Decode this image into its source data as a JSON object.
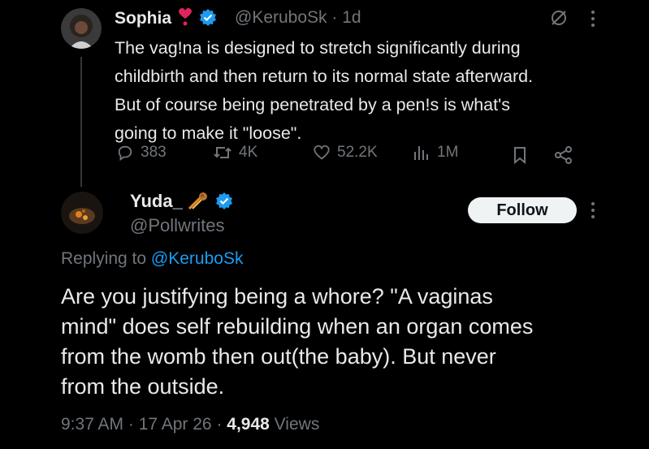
{
  "parent": {
    "name": "Sophia",
    "name_emoji": "heart-exclamation-icon",
    "handle": "@KeruboSk",
    "time": "1d",
    "text_lines": [
      "The vag!na is designed to stretch significantly during",
      "childbirth and then return to its normal state afterward.",
      "But of course being penetrated by a pen!s is what's",
      "going to make it \"loose\"."
    ],
    "stats": {
      "replies": "383",
      "reposts": "4K",
      "likes": "52.2K",
      "views": "1M"
    }
  },
  "reply": {
    "name": "Yuda_",
    "name_emoji": "meteor-icon",
    "handle": "@Pollwrites",
    "follow_label": "Follow",
    "replying_prefix": "Replying to ",
    "replying_to": "@KeruboSk",
    "text_lines": [
      "Are you justifying being a whore? \"A vaginas",
      "mind\" does self rebuilding when an organ comes",
      "from the womb then out(the baby). But never",
      "from the outside."
    ],
    "timestamp": "9:37 AM · 17 Apr 26 · ",
    "views_count": "4,948",
    "views_label": " Views"
  },
  "colors": {
    "background": "#000000",
    "text": "#e7e9ea",
    "muted": "#71767b",
    "accent": "#1d9bf0",
    "button_bg": "#eff3f4"
  }
}
